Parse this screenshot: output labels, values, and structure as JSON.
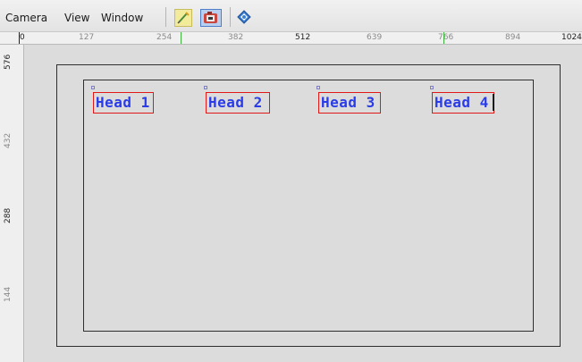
{
  "menu": {
    "items": [
      {
        "label": "Camera"
      },
      {
        "label": "View"
      },
      {
        "label": "Window"
      }
    ]
  },
  "toolbar": {
    "tools": [
      {
        "icon": "pencil-tool-icon",
        "active": false
      },
      {
        "icon": "camera-tool-icon",
        "active": true
      },
      {
        "icon": "diamond-tool-icon",
        "active": false
      }
    ]
  },
  "ruler_top": {
    "ticks": [
      "0",
      "127",
      "254",
      "382",
      "512",
      "639",
      "766",
      "894",
      "1024"
    ]
  },
  "ruler_left": {
    "ticks": [
      "576",
      "432",
      "288",
      "144"
    ]
  },
  "canvas": {
    "heads": [
      "Head 1",
      "Head 2",
      "Head 3",
      "Head 4"
    ]
  },
  "colors": {
    "head_text": "#2a3ce8",
    "head_border": "#e01818",
    "canvas_bg": "#dcdcdc",
    "frame": "#2f2f2f"
  }
}
